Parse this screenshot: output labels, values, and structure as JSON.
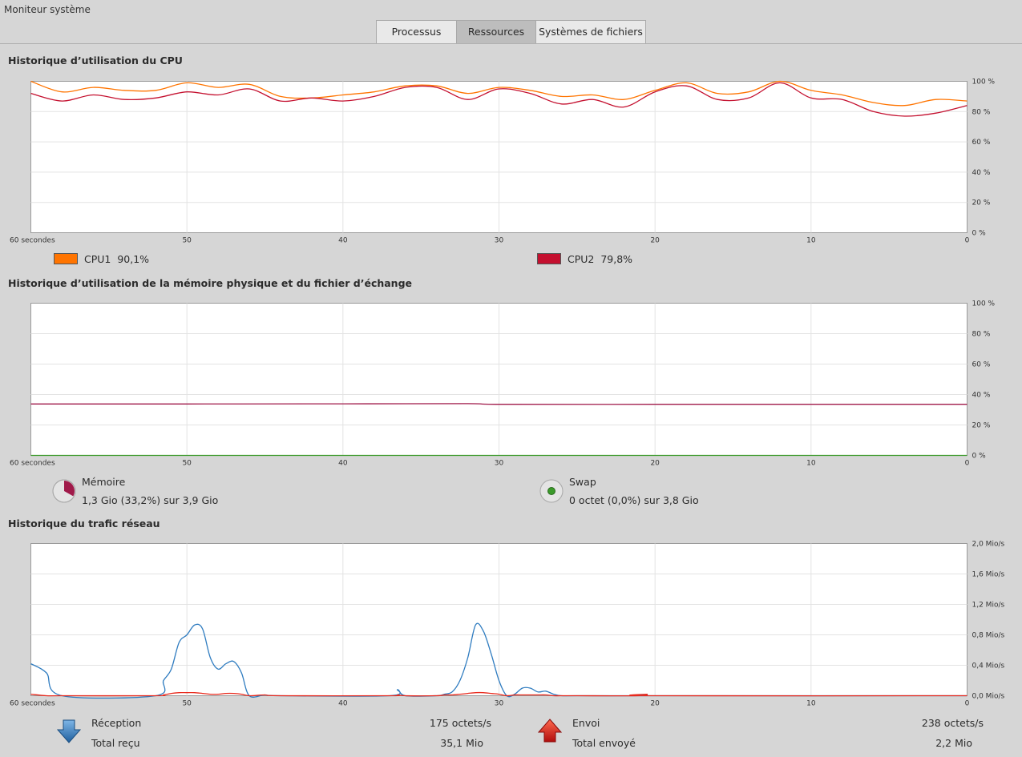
{
  "window": {
    "title": "Moniteur système"
  },
  "tabs": [
    {
      "label": "Processus",
      "active": false
    },
    {
      "label": "Ressources",
      "active": true
    },
    {
      "label": "Systèmes de fichiers",
      "active": false
    }
  ],
  "x_axis_labels": [
    "60 secondes",
    "50",
    "40",
    "30",
    "20",
    "10",
    "0"
  ],
  "cpu": {
    "title": "Historique d’utilisation du CPU",
    "y_labels": [
      "100 %",
      "80 %",
      "60 %",
      "40 %",
      "20 %",
      "0 %"
    ],
    "cpu1": {
      "label": "CPU1",
      "value": "90,1%",
      "color": "#ff7400"
    },
    "cpu2": {
      "label": "CPU2",
      "value": "79,8%",
      "color": "#c4102f"
    }
  },
  "memory": {
    "title": "Historique d’utilisation de la mémoire physique et du fichier d’échange",
    "y_labels": [
      "100 %",
      "80 %",
      "60 %",
      "40 %",
      "20 %",
      "0 %"
    ],
    "mem": {
      "label": "Mémoire",
      "detail": "1,3 Gio (33,2%) sur 3,9 Gio",
      "color": "#a01a4a"
    },
    "swap": {
      "label": "Swap",
      "detail": "0 octet (0,0%) sur 3,8 Gio",
      "color": "#3a9a2a"
    }
  },
  "network": {
    "title": "Historique du trafic réseau",
    "y_labels": [
      "2,0 Mio/s",
      "1,6 Mio/s",
      "1,2 Mio/s",
      "0,8 Mio/s",
      "0,4 Mio/s",
      "0,0 Mio/s"
    ],
    "recv": {
      "label": "Réception",
      "rate": "175 octets/s",
      "total_label": "Total reçu",
      "total": "35,1 Mio",
      "color": "#2f7cc0"
    },
    "send": {
      "label": "Envoi",
      "rate": "238 octets/s",
      "total_label": "Total envoyé",
      "total": "2,2 Mio",
      "color": "#e8291c"
    }
  },
  "chart_data": [
    {
      "type": "line",
      "x": [
        60,
        58,
        56,
        54,
        52,
        50,
        48,
        46,
        44,
        42,
        40,
        38,
        36,
        34,
        32,
        30,
        28,
        26,
        24,
        22,
        20,
        18,
        16,
        14,
        12,
        10,
        8,
        6,
        4,
        2,
        0
      ],
      "series": [
        {
          "name": "CPU1",
          "values": [
            100,
            93,
            96,
            94,
            94,
            99,
            96,
            98,
            90,
            89,
            91,
            93,
            97,
            97,
            92,
            96,
            94,
            90,
            91,
            88,
            94,
            99,
            92,
            93,
            100,
            94,
            91,
            86,
            84,
            88,
            87
          ]
        },
        {
          "name": "CPU2",
          "values": [
            92,
            87,
            91,
            88,
            89,
            93,
            91,
            95,
            87,
            89,
            87,
            90,
            96,
            96,
            88,
            95,
            92,
            85,
            88,
            83,
            93,
            97,
            88,
            89,
            99,
            89,
            88,
            80,
            77,
            79,
            84
          ]
        }
      ],
      "ylim": [
        0,
        100
      ],
      "xlim": [
        60,
        0
      ]
    },
    {
      "type": "line",
      "x": [
        60,
        50,
        40,
        32,
        30,
        20,
        10,
        0
      ],
      "series": [
        {
          "name": "Mémoire",
          "values": [
            33.8,
            33.8,
            33.9,
            34.0,
            33.6,
            33.6,
            33.6,
            33.6
          ]
        },
        {
          "name": "Swap",
          "values": [
            0,
            0,
            0,
            0,
            0,
            0,
            0,
            0
          ]
        }
      ],
      "ylim": [
        0,
        100
      ],
      "xlim": [
        60,
        0
      ]
    },
    {
      "type": "line",
      "x": [
        60,
        59,
        58,
        52,
        51.5,
        51,
        50.5,
        50,
        49.5,
        49,
        48.5,
        48,
        47.5,
        47,
        46.5,
        46,
        45,
        44,
        37,
        36.5,
        36,
        34,
        33.5,
        33,
        32.5,
        32,
        31.5,
        31,
        30.5,
        30,
        29.5,
        29,
        28.5,
        28,
        27.5,
        27,
        26.5,
        26,
        25,
        21,
        20.5,
        20,
        0
      ],
      "series": [
        {
          "name": "Réception",
          "values": [
            0.42,
            0.3,
            0,
            0,
            0.2,
            0.35,
            0.7,
            0.8,
            0.93,
            0.88,
            0.5,
            0.35,
            0.42,
            0.45,
            0.3,
            0,
            0.01,
            0,
            0,
            0.08,
            0,
            0,
            0.02,
            0.05,
            0.2,
            0.5,
            0.93,
            0.85,
            0.55,
            0.2,
            0,
            0.02,
            0.1,
            0.1,
            0.05,
            0.06,
            0.02,
            0,
            0,
            0,
            0.01,
            0,
            0
          ]
        },
        {
          "name": "Envoi",
          "values": [
            0.02,
            0,
            0,
            0,
            0.01,
            0.03,
            0.04,
            0.04,
            0.04,
            0.03,
            0.02,
            0.02,
            0.03,
            0.03,
            0.02,
            0,
            0.01,
            0,
            0,
            0.01,
            0,
            0,
            0.01,
            0.01,
            0.02,
            0.03,
            0.04,
            0.04,
            0.03,
            0.02,
            0,
            0.01,
            0.01,
            0.01,
            0.01,
            0.01,
            0,
            0,
            0,
            0,
            0.02,
            0,
            0
          ]
        }
      ],
      "ylim": [
        0,
        2.0
      ],
      "xlim": [
        60,
        0
      ]
    }
  ]
}
